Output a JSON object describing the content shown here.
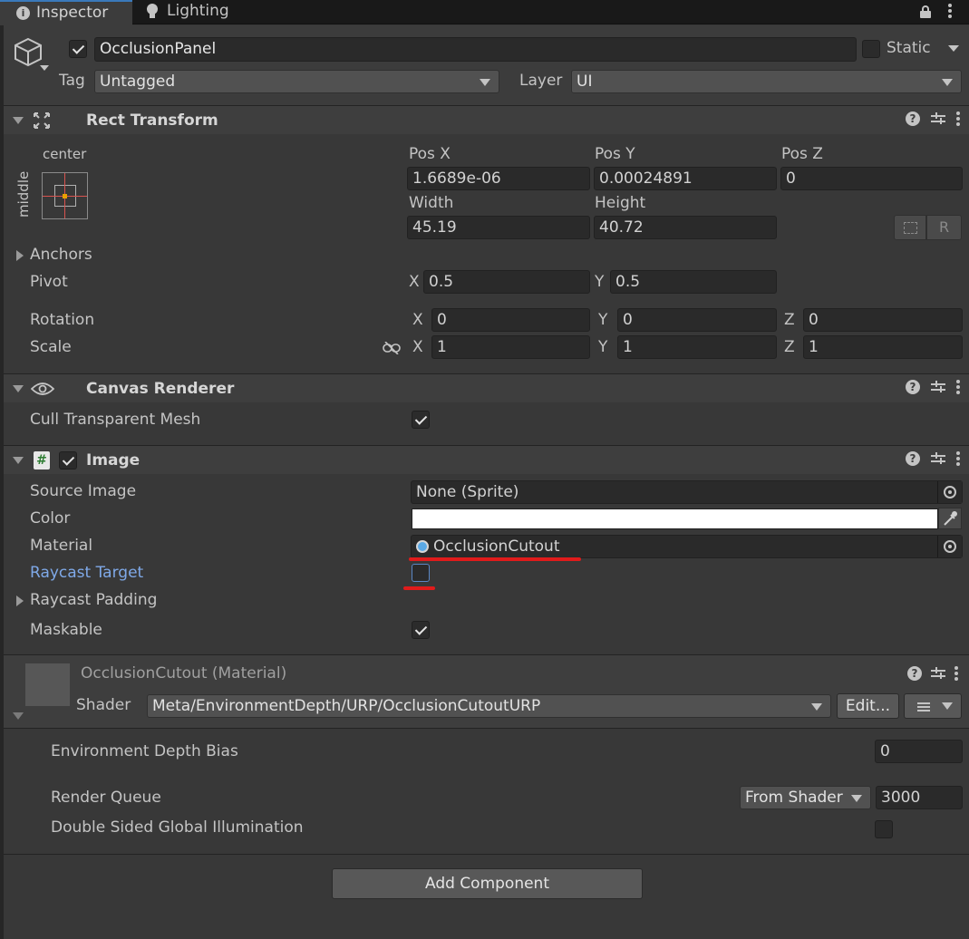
{
  "tabs": [
    {
      "label": "Inspector",
      "icon": "info-icon"
    },
    {
      "label": "Lighting",
      "icon": "bulb-icon"
    }
  ],
  "object": {
    "active": true,
    "name": "OcclusionPanel",
    "static_label": "Static",
    "static": false,
    "tag_label": "Tag",
    "tag_value": "Untagged",
    "layer_label": "Layer",
    "layer_value": "UI"
  },
  "rect_transform": {
    "title": "Rect Transform",
    "anchor_preset_h": "center",
    "anchor_preset_v": "middle",
    "pos_x_label": "Pos X",
    "pos_y_label": "Pos Y",
    "pos_z_label": "Pos Z",
    "pos_x": "1.6689e-06",
    "pos_y": "0.00024891",
    "pos_z": "0",
    "width_label": "Width",
    "height_label": "Height",
    "width": "45.19",
    "height": "40.72",
    "raw_edit_label": "R",
    "anchors_label": "Anchors",
    "pivot_label": "Pivot",
    "pivot_x": "0.5",
    "pivot_y": "0.5",
    "rotation_label": "Rotation",
    "rot_x": "0",
    "rot_y": "0",
    "rot_z": "0",
    "scale_label": "Scale",
    "scale_x": "1",
    "scale_y": "1",
    "scale_z": "1",
    "x": "X",
    "y": "Y",
    "z": "Z"
  },
  "canvas_renderer": {
    "title": "Canvas Renderer",
    "cull_label": "Cull Transparent Mesh",
    "cull": true
  },
  "image": {
    "title": "Image",
    "enabled": true,
    "source_label": "Source Image",
    "source_value": "None (Sprite)",
    "color_label": "Color",
    "color_value": "#ffffff",
    "material_label": "Material",
    "material_value": "OcclusionCutout",
    "raycast_label": "Raycast Target",
    "raycast": false,
    "raycast_padding_label": "Raycast Padding",
    "maskable_label": "Maskable",
    "maskable": true
  },
  "material": {
    "title": "OcclusionCutout (Material)",
    "shader_label": "Shader",
    "shader_value": "Meta/EnvironmentDepth/URP/OcclusionCutoutURP",
    "edit_label": "Edit...",
    "depth_bias_label": "Environment Depth Bias",
    "depth_bias": "0",
    "render_queue_label": "Render Queue",
    "render_queue_mode": "From Shader",
    "render_queue": "3000",
    "dsgi_label": "Double Sided Global Illumination",
    "dsgi": false
  },
  "add_component_label": "Add Component",
  "colors": {
    "panel_bg": "#383838",
    "highlight_label": "#7fa9e8",
    "annotation_red": "#e01b1b"
  }
}
